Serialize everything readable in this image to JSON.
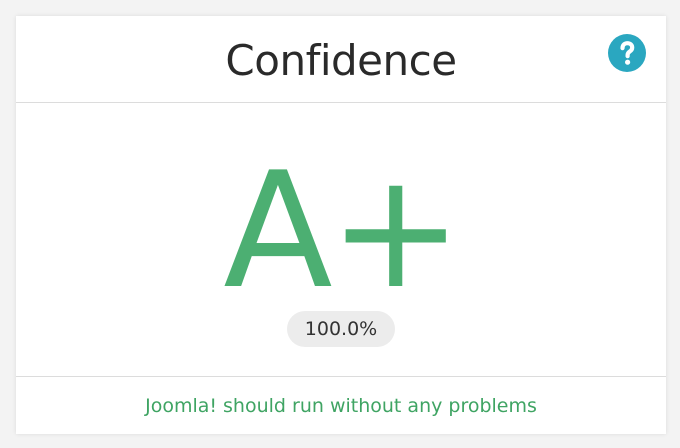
{
  "card": {
    "title": "Confidence",
    "help_icon": "question-mark-circle-icon",
    "grade": "A+",
    "score": "100.0%",
    "message": "Joomla! should run without any problems"
  },
  "colors": {
    "grade": "#4caf72",
    "message": "#3fa463",
    "help_icon_bg": "#2aa7c0",
    "pill_bg": "#ececec"
  }
}
